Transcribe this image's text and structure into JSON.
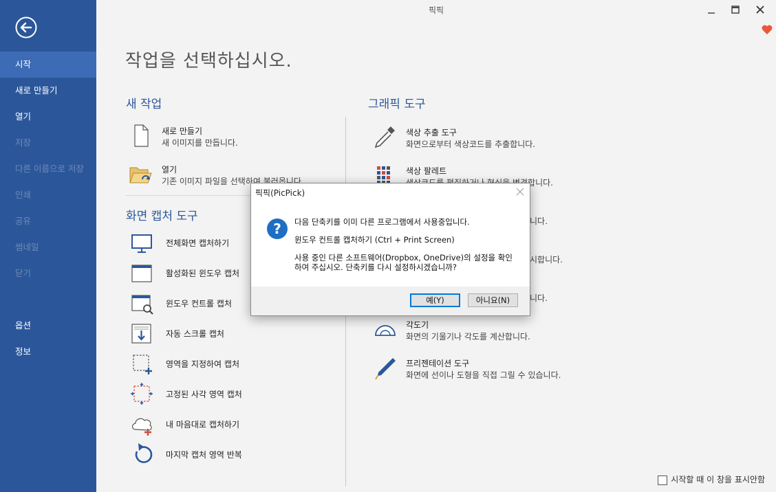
{
  "window": {
    "title": "픽픽"
  },
  "sidebar": {
    "items": [
      {
        "label": "시작",
        "state": "active"
      },
      {
        "label": "새로 만들기",
        "state": "normal"
      },
      {
        "label": "열기",
        "state": "normal"
      },
      {
        "label": "저장",
        "state": "disabled"
      },
      {
        "label": "다른 이름으로 저장",
        "state": "disabled"
      },
      {
        "label": "인쇄",
        "state": "disabled"
      },
      {
        "label": "공유",
        "state": "disabled"
      },
      {
        "label": "썸네일",
        "state": "disabled"
      },
      {
        "label": "닫기",
        "state": "disabled"
      },
      {
        "label": "옵션",
        "state": "normal"
      },
      {
        "label": "정보",
        "state": "normal"
      }
    ]
  },
  "main": {
    "heading": "작업을 선택하십시오.",
    "new_task": {
      "title": "새 작업",
      "items": [
        {
          "label": "새로 만들기",
          "desc": "새 이미지를 만듭니다.",
          "icon": "new-file-icon"
        },
        {
          "label": "열기",
          "desc": "기존 이미지 파일을 선택하여 불러옵니다.",
          "icon": "open-folder-icon"
        }
      ]
    },
    "capture": {
      "title": "화면 캡처 도구",
      "items": [
        {
          "label": "전체화면 캡처하기",
          "icon": "monitor-icon"
        },
        {
          "label": "활성화된 윈도우 캡처",
          "icon": "window-icon"
        },
        {
          "label": "윈도우 컨트롤 캡처",
          "icon": "window-control-icon"
        },
        {
          "label": "자동 스크롤 캡처",
          "icon": "scroll-icon"
        },
        {
          "label": "영역을 지정하여 캡처",
          "icon": "region-icon"
        },
        {
          "label": "고정된 사각 영역 캡처",
          "icon": "fixed-region-icon"
        },
        {
          "label": "내 마음대로 캡처하기",
          "icon": "freehand-icon"
        },
        {
          "label": "마지막 캡처 영역 반복",
          "icon": "repeat-icon"
        }
      ]
    },
    "graphic": {
      "title": "그래픽 도구",
      "items": [
        {
          "label": "색상 추출 도구",
          "desc": "화면으로부터 색상코드를 추출합니다.",
          "icon": "eyedropper-icon"
        },
        {
          "label": "색상 팔레트",
          "desc": "색상코드를 편집하거나 형식을 변경합니다.",
          "icon": "palette-icon"
        },
        {
          "label": "",
          "desc": "니다.",
          "icon": ""
        },
        {
          "label": "",
          "desc": "시합니다.",
          "icon": ""
        },
        {
          "label": "",
          "desc": "니다.",
          "icon": ""
        },
        {
          "label": "각도기",
          "desc": "화면의 기울기나 각도를 계산합니다.",
          "icon": "protractor-icon"
        },
        {
          "label": "프리젠테이션 도구",
          "desc": "화면에 선이나 도형을 직접 그릴 수 있습니다.",
          "icon": "pen-icon"
        }
      ]
    },
    "startup_checkbox": "시작할 때 이 창을 표시안함"
  },
  "dialog": {
    "title": "픽픽(PicPick)",
    "line1": "다음 단축키를 이미 다른 프로그램에서 사용중입니다.",
    "line2": "윈도우 컨트롤 캡처하기 (Ctrl + Print Screen)",
    "line3": "사용 중인 다른 소프트웨어(Dropbox, OneDrive)의 설정을 확인",
    "line4": "하여 주십시오. 단축키를 다시 설정하시겠습니까?",
    "yes_label": "예(Y)",
    "no_label": "아니요(N)",
    "icon": "question-icon"
  },
  "colors": {
    "sidebar": "#2b579a",
    "sidebar_active": "#3d6bb5",
    "accent": "#2b579a",
    "heart": "#e8593c"
  }
}
